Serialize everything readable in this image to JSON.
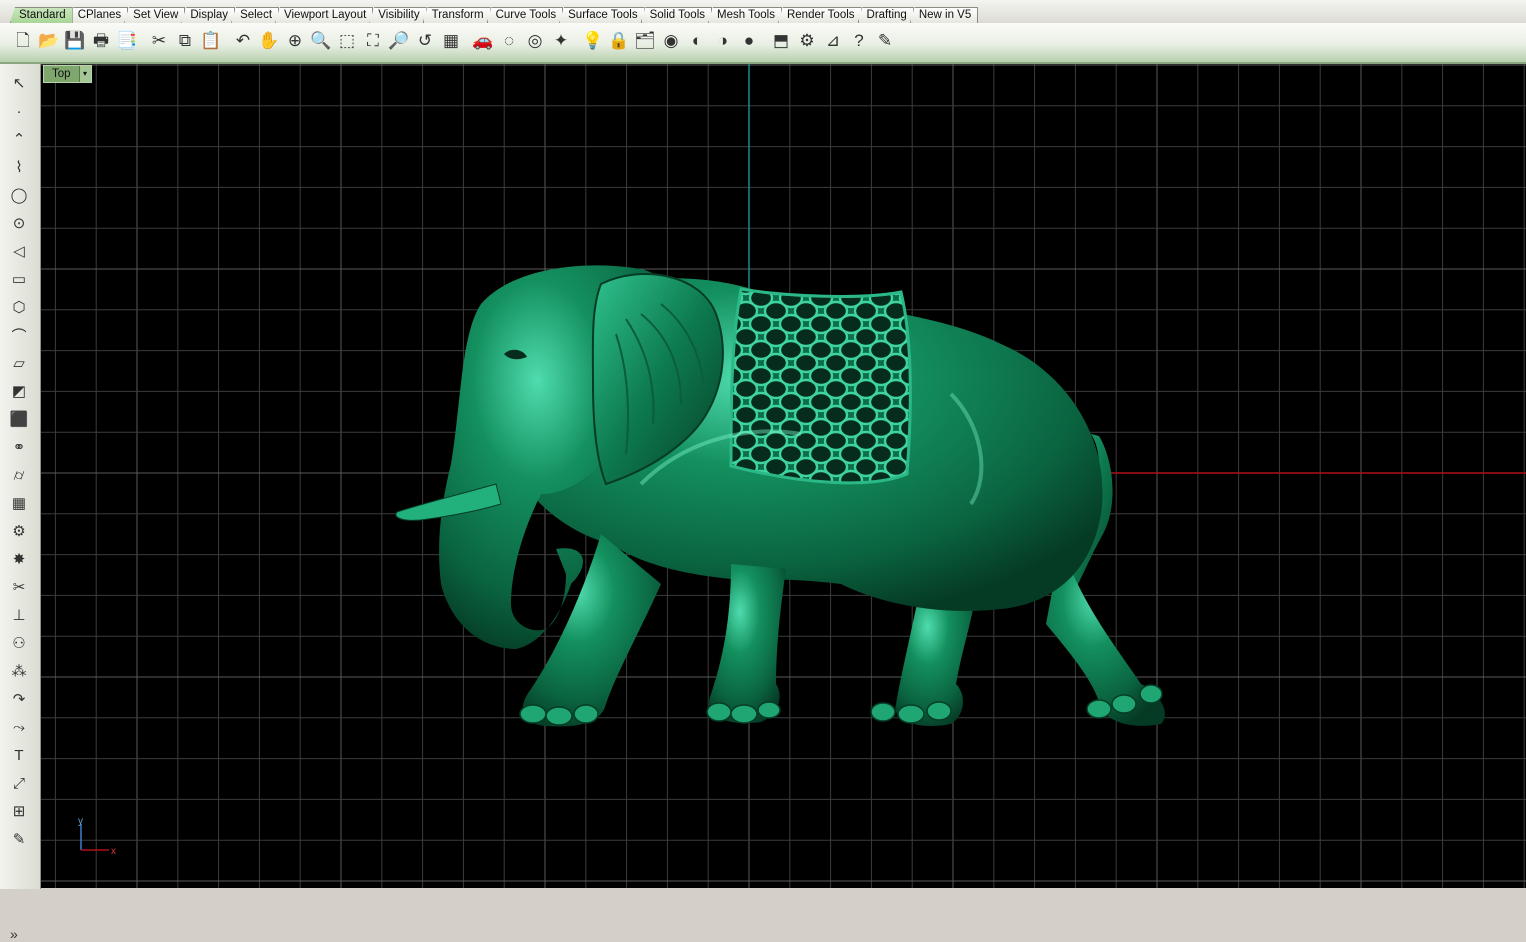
{
  "tabs": [
    "Standard",
    "CPlanes",
    "Set View",
    "Display",
    "Select",
    "Viewport Layout",
    "Visibility",
    "Transform",
    "Curve Tools",
    "Surface Tools",
    "Solid Tools",
    "Mesh Tools",
    "Render Tools",
    "Drafting",
    "New in V5"
  ],
  "active_tab": "Standard",
  "toolbar_icons": [
    "new-document-icon",
    "open-folder-icon",
    "save-icon",
    "print-icon",
    "import-icon",
    "cut-icon",
    "copy-icon",
    "paste-icon",
    "undo-icon",
    "pan-icon",
    "rotate-view-icon",
    "zoom-icon",
    "zoom-window-icon",
    "zoom-extents-icon",
    "zoom-selected-icon",
    "undo-view-icon",
    "viewport-layout-icon",
    "car-render-icon",
    "hide-object-icon",
    "show-selected-icon",
    "object-snap-icon",
    "light-bulb-icon",
    "lock-icon",
    "layer-icon",
    "color-wheel-icon",
    "shaded-sphere-icon",
    "rendered-sphere-icon",
    "blue-sphere-icon",
    "rectangle-select-icon",
    "options-gear-icon",
    "dimension-icon",
    "help-icon",
    "tips-icon"
  ],
  "toolbar_glyphs": [
    "🗋",
    "📂",
    "💾",
    "🖶",
    "📑",
    "✂",
    "⧉",
    "📋",
    "↶",
    "✋",
    "⊕",
    "🔍",
    "⬚",
    "⛶",
    "🔎",
    "↺",
    "▦",
    "🚗",
    "◌",
    "◎",
    "✦",
    "💡",
    "🔒",
    "🗂",
    "◉",
    "◐",
    "◑",
    "●",
    "⬒",
    "⚙",
    "⊿",
    "?",
    "✎"
  ],
  "left_tools": [
    {
      "icon": "select-arrow-icon",
      "glyph": "↖"
    },
    {
      "icon": "point-icon",
      "glyph": "·"
    },
    {
      "icon": "polyline-icon",
      "glyph": "⌃"
    },
    {
      "icon": "curve-icon",
      "glyph": "⌇"
    },
    {
      "icon": "circle-icon",
      "glyph": "◯"
    },
    {
      "icon": "ellipse-icon",
      "glyph": "⊙"
    },
    {
      "icon": "arc-icon",
      "glyph": "◁"
    },
    {
      "icon": "rectangle-icon",
      "glyph": "▭"
    },
    {
      "icon": "polygon-icon",
      "glyph": "⬡"
    },
    {
      "icon": "fillet-curve-icon",
      "glyph": "⌒"
    },
    {
      "icon": "surface-icon",
      "glyph": "▱"
    },
    {
      "icon": "extrude-surface-icon",
      "glyph": "◩"
    },
    {
      "icon": "box-solid-icon",
      "glyph": "⬛"
    },
    {
      "icon": "boolean-union-icon",
      "glyph": "⚭"
    },
    {
      "icon": "cylinder-icon",
      "glyph": "⌭"
    },
    {
      "icon": "mesh-icon",
      "glyph": "▦"
    },
    {
      "icon": "gear-tool-icon",
      "glyph": "⚙"
    },
    {
      "icon": "explode-icon",
      "glyph": "✸"
    },
    {
      "icon": "trim-icon",
      "glyph": "✂"
    },
    {
      "icon": "split-icon",
      "glyph": "⊥"
    },
    {
      "icon": "group-icon",
      "glyph": "⚇"
    },
    {
      "icon": "array-icon",
      "glyph": "⁂"
    },
    {
      "icon": "rotate-icon",
      "glyph": "↷"
    },
    {
      "icon": "transform-icon",
      "glyph": "⤳"
    },
    {
      "icon": "text-icon",
      "glyph": "T"
    },
    {
      "icon": "scale-icon",
      "glyph": "⤢"
    },
    {
      "icon": "block-icon",
      "glyph": "⊞"
    },
    {
      "icon": "analyze-icon",
      "glyph": "✎"
    }
  ],
  "more_tools_glyph": "»",
  "viewport": {
    "name": "Top",
    "dropdown_glyph": "▾",
    "axis_x_label": "x",
    "axis_y_label": "y"
  },
  "colors": {
    "grid": "#3c3c3c",
    "grid_major": "#5a5a5a",
    "x_axis": "#b0101a",
    "y_axis": "#1c8a8e",
    "model": "#137a52",
    "background": "#000000"
  }
}
